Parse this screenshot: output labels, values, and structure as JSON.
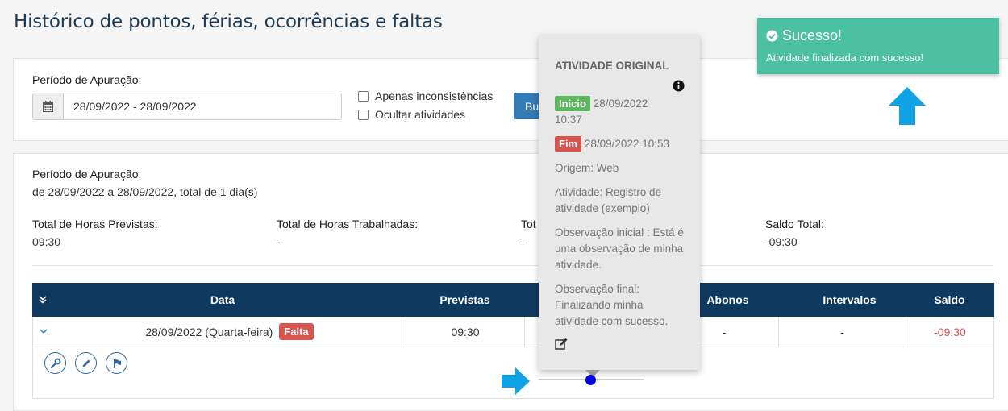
{
  "page": {
    "title": "Histórico de pontos, férias, ocorrências e faltas"
  },
  "filter": {
    "period_label": "Período de Apuração:",
    "date_range_value": "28/09/2022 - 28/09/2022",
    "calendar_icon": "calendar-icon",
    "checkboxes": [
      {
        "label": "Apenas inconsistências",
        "checked": false
      },
      {
        "label": "Ocultar atividades",
        "checked": false
      }
    ],
    "search_button": "Bus"
  },
  "summary": {
    "period_label": "Período de Apuração:",
    "period_text": "de 28/09/2022 a 28/09/2022, total de 1 dia(s)",
    "totals": [
      {
        "label": "Total de Horas Previstas:",
        "value": "09:30"
      },
      {
        "label": "Total de Horas Trabalhadas:",
        "value": "-"
      },
      {
        "label": "Tot",
        "value": "-"
      },
      {
        "label": "Saldo Total:",
        "value": "-09:30"
      }
    ]
  },
  "table": {
    "headers": [
      "Data",
      "Previstas",
      "",
      "Abonos",
      "Intervalos",
      "Saldo"
    ],
    "row": {
      "date": "28/09/2022 (Quarta-feira)",
      "badge": "Falta",
      "previstas": "09:30",
      "abonos": "-",
      "intervalos": "-",
      "saldo": "-09:30"
    },
    "actions": [
      "wrench-icon",
      "pencil-icon",
      "flag-icon"
    ]
  },
  "toast": {
    "title": "Sucesso!",
    "message": "Atividade finalizada com sucesso!",
    "color": "#4cc1a1"
  },
  "popover": {
    "title": "ATIVIDADE ORIGINAL",
    "inicio_tag": "Inicio",
    "inicio_date": "28/09/2022",
    "inicio_time": "10:37",
    "fim_tag": "Fim",
    "fim_datetime": "28/09/2022 10:53",
    "origem": "Origem: Web",
    "atividade": "Atividade: Registro de atividade (exemplo)",
    "obs_inicial": "Observação inicial : Está é uma observação de minha atividade.",
    "obs_final": "Observação final: Finalizando minha atividade com sucesso."
  },
  "colors": {
    "header": "#0f3a5f",
    "negative": "#d9534f",
    "arrow": "#0fa3e6"
  }
}
